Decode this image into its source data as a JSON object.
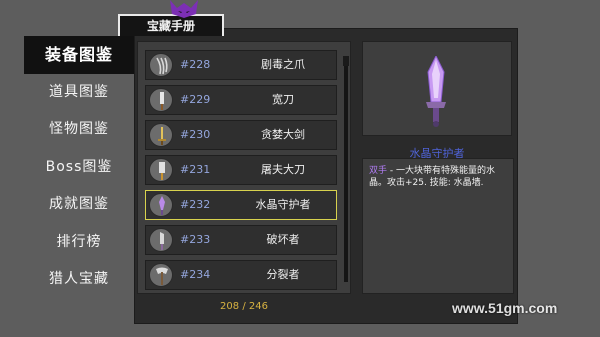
{
  "book": {
    "title": "宝藏手册"
  },
  "sidebar": {
    "items": [
      {
        "label": "装备图鉴",
        "active": true
      },
      {
        "label": "道具图鉴"
      },
      {
        "label": "怪物图鉴"
      },
      {
        "label": "Boss图鉴"
      },
      {
        "label": "成就图鉴"
      },
      {
        "label": "排行榜"
      },
      {
        "label": "猎人宝藏"
      }
    ]
  },
  "list": {
    "items": [
      {
        "num": "#228",
        "name": "剧毒之爪",
        "icon": "claw-icon"
      },
      {
        "num": "#229",
        "name": "宽刀",
        "icon": "broad-blade-icon"
      },
      {
        "num": "#230",
        "name": "贪婪大剑",
        "icon": "greatsword-icon"
      },
      {
        "num": "#231",
        "name": "屠夫大刀",
        "icon": "butcher-blade-icon"
      },
      {
        "num": "#232",
        "name": "水晶守护者",
        "icon": "crystal-sword-icon",
        "selected": true
      },
      {
        "num": "#233",
        "name": "破坏者",
        "icon": "breaker-blade-icon"
      },
      {
        "num": "#234",
        "name": "分裂者",
        "icon": "splitter-axe-icon"
      }
    ],
    "count": "208 / 246"
  },
  "detail": {
    "name": "水晶守护者",
    "tag": "双手",
    "description": " - 一大块带有特殊能量的水晶。攻击+25. 技能: 水晶墙."
  },
  "watermark": "www.51gm.com",
  "colors": {
    "selected_border": "#d8d24e",
    "item_number": "#94a6dd",
    "detail_name": "#4f63d8",
    "tag": "#b07cf3",
    "count": "#d7b241"
  }
}
